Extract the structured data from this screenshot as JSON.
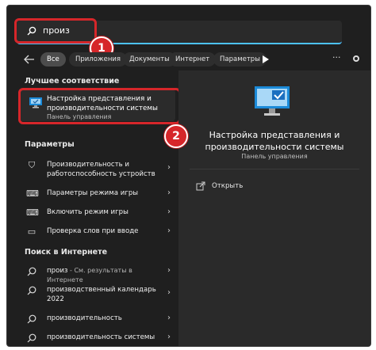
{
  "search": {
    "query": "произ"
  },
  "filters": {
    "chips": [
      "Все",
      "Приложения",
      "Документы",
      "Интернет",
      "Параметры"
    ],
    "more": "..."
  },
  "badges": {
    "one": "1",
    "two": "2"
  },
  "best_match": {
    "header": "Лучшее соответствие",
    "title": "Настройка представления и производительности системы",
    "subtitle": "Панель управления"
  },
  "settings": {
    "header": "Параметры",
    "items": [
      {
        "label": "Производительность и работоспособность устройств",
        "icon": "shield-icon"
      },
      {
        "label": "Параметры режима игры",
        "icon": "gamepad-icon"
      },
      {
        "label": "Включить режим игры",
        "icon": "gamepad-icon"
      },
      {
        "label": "Проверка слов при вводе",
        "icon": "keyboard-icon"
      }
    ]
  },
  "web": {
    "header": "Поиск в Интернете",
    "items": [
      {
        "label": "произ",
        "suffix": " - См. результаты в Интернете"
      },
      {
        "label": "производственный календарь 2022"
      },
      {
        "label": "производительность"
      },
      {
        "label": "производительность системы"
      }
    ]
  },
  "preview": {
    "title": "Настройка представления и производительности системы",
    "subtitle": "Панель управления",
    "open": "Открыть"
  },
  "colors": {
    "accent": "#4cc2ff",
    "highlight": "#d6262a",
    "background": "#1f1f1f"
  }
}
